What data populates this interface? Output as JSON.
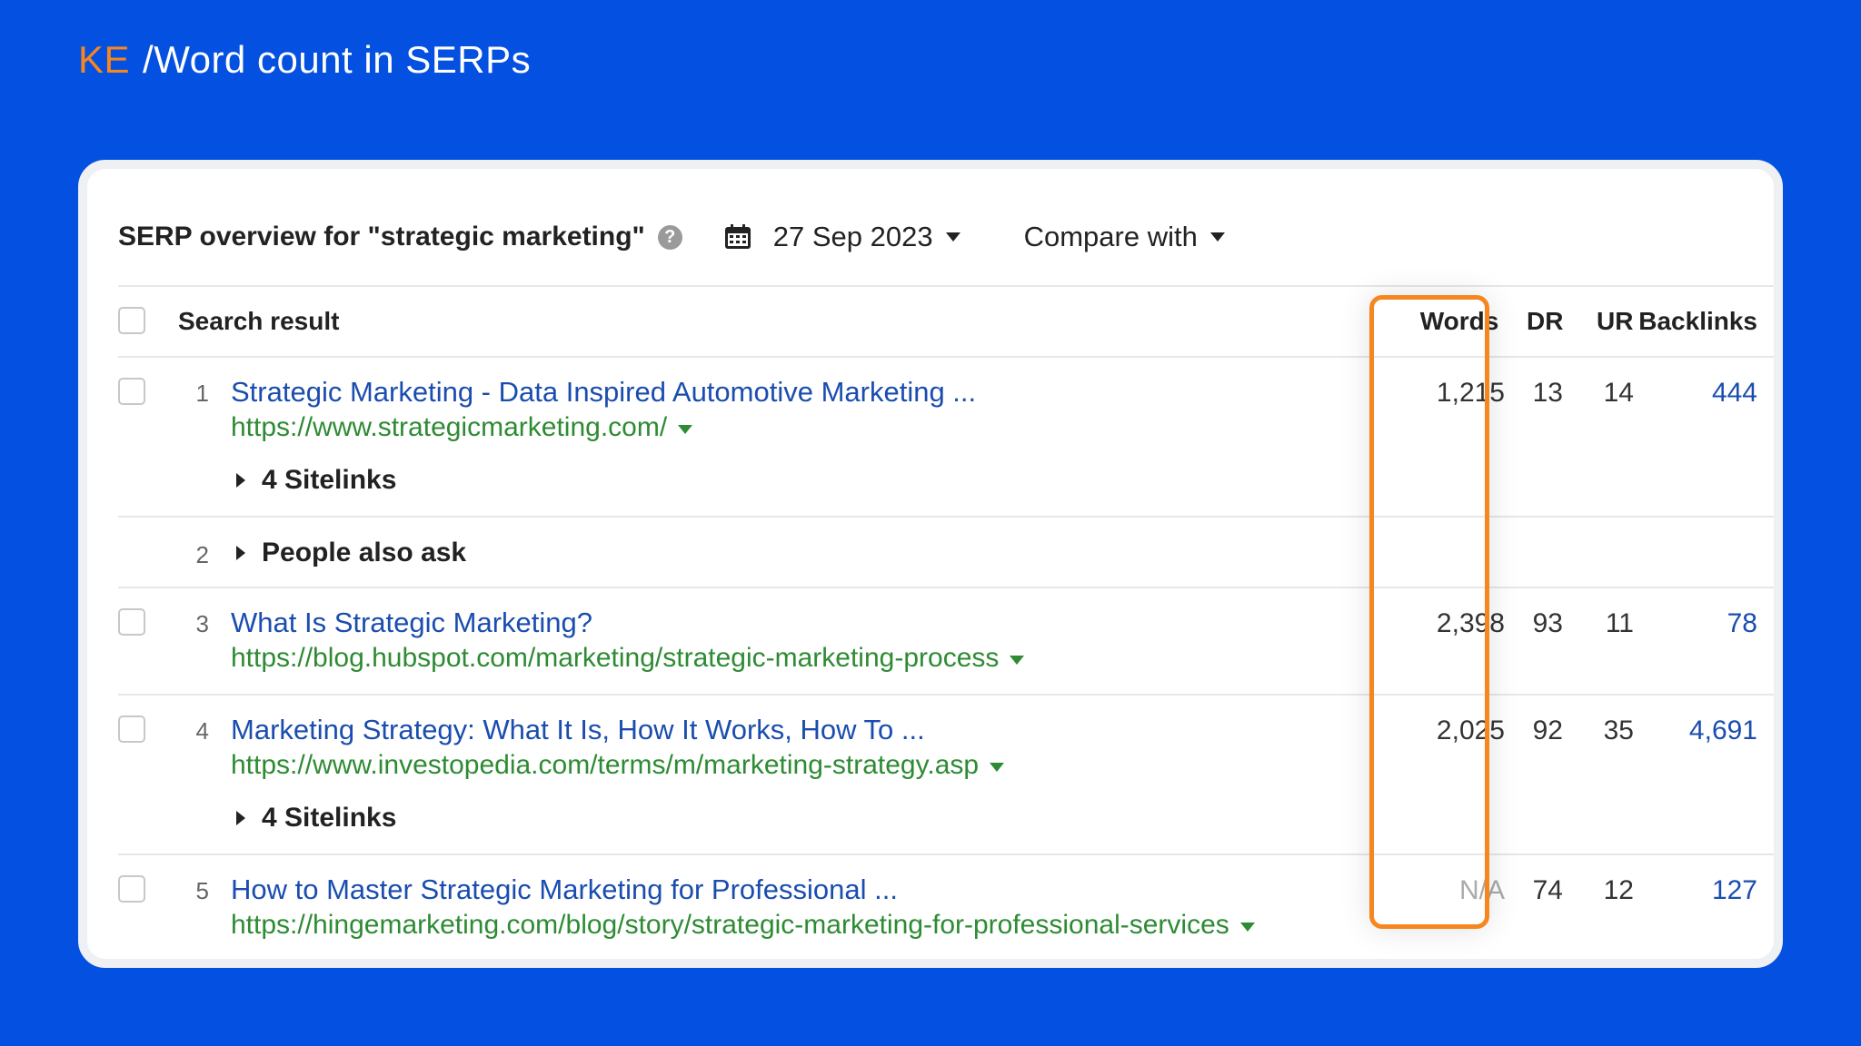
{
  "page_title": {
    "tag": "KE",
    "text": "/Word count in SERPs"
  },
  "serp": {
    "title": "SERP overview for \"strategic marketing\"",
    "help_glyph": "?",
    "date": "27 Sep 2023",
    "compare_label": "Compare with"
  },
  "columns": {
    "search_result": "Search result",
    "words": "Words",
    "dr": "DR",
    "ur": "UR",
    "backlinks": "Backlinks"
  },
  "rows": [
    {
      "rank": "1",
      "title": "Strategic Marketing - Data Inspired Automotive Marketing ...",
      "url": "https://www.strategicmarketing.com/",
      "sitelinks": "4 Sitelinks",
      "words": "1,215",
      "dr": "13",
      "ur": "14",
      "backlinks": "444"
    },
    {
      "rank": "2",
      "label": "People also ask"
    },
    {
      "rank": "3",
      "title": "What Is Strategic Marketing?",
      "url": "https://blog.hubspot.com/marketing/strategic-marketing-process",
      "words": "2,398",
      "dr": "93",
      "ur": "11",
      "backlinks": "78"
    },
    {
      "rank": "4",
      "title": "Marketing Strategy: What It Is, How It Works, How To ...",
      "url": "https://www.investopedia.com/terms/m/marketing-strategy.asp",
      "sitelinks": "4 Sitelinks",
      "words": "2,025",
      "dr": "92",
      "ur": "35",
      "backlinks": "4,691"
    },
    {
      "rank": "5",
      "title": "How to Master Strategic Marketing for Professional ...",
      "url": "https://hingemarketing.com/blog/story/strategic-marketing-for-professional-services",
      "words": "N/A",
      "dr": "74",
      "ur": "12",
      "backlinks": "127"
    }
  ],
  "colors": {
    "background": "#0450E0",
    "accent": "#F6861F",
    "link": "#1A4DAF",
    "url": "#2E8B33"
  }
}
